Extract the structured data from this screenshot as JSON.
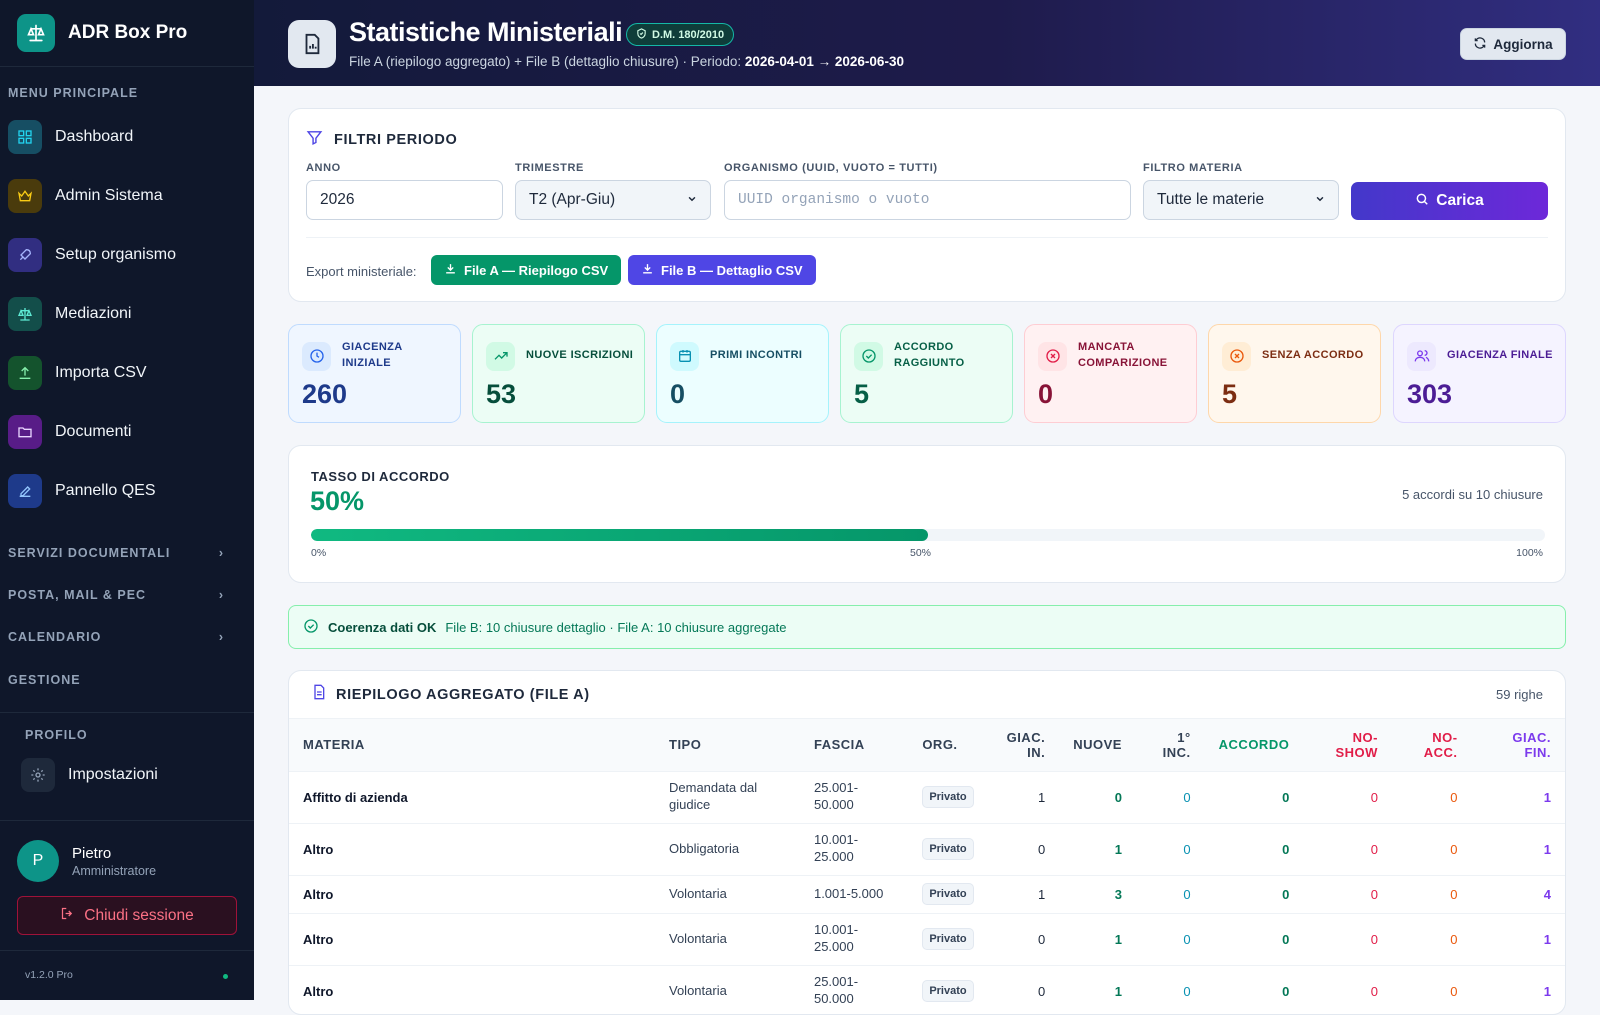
{
  "app": {
    "name": "ADR Box Pro",
    "version": "v1.2.0 Pro"
  },
  "sidebar": {
    "main_section": "MENU PRINCIPALE",
    "items": [
      {
        "label": "Dashboard",
        "icon": "grid-icon"
      },
      {
        "label": "Admin Sistema",
        "icon": "crown-icon"
      },
      {
        "label": "Setup organismo",
        "icon": "rocket-icon"
      },
      {
        "label": "Mediazioni",
        "icon": "scale-icon"
      },
      {
        "label": "Importa CSV",
        "icon": "upload-icon"
      },
      {
        "label": "Documenti",
        "icon": "folder-icon"
      },
      {
        "label": "Pannello QES",
        "icon": "edit-icon"
      }
    ],
    "groups": [
      "SERVIZI DOCUMENTALI",
      "POSTA, MAIL & PEC",
      "CALENDARIO"
    ],
    "gestione": "GESTIONE",
    "profile_section": "PROFILO",
    "settings_label": "Impostazioni",
    "user": {
      "initial": "P",
      "name": "Pietro",
      "role": "Amministratore"
    },
    "logout_label": "Chiudi sessione"
  },
  "header": {
    "title": "Statistiche Ministeriali",
    "badge": "D.M. 180/2010",
    "subtitle_prefix": "File A (riepilogo aggregato) + File B (dettaglio chiusure) · Periodo: ",
    "period": "2026-04-01 → 2026-06-30",
    "refresh_label": "Aggiorna"
  },
  "filters": {
    "title": "FILTRI PERIODO",
    "anno_label": "ANNO",
    "anno_value": "2026",
    "trimestre_label": "TRIMESTRE",
    "trimestre_value": "T2 (Apr-Giu)",
    "organismo_label": "ORGANISMO (UUID, VUOTO = TUTTI)",
    "organismo_placeholder": "UUID organismo o vuoto",
    "materia_label": "FILTRO MATERIA",
    "materia_value": "Tutte le materie",
    "load_label": "Carica",
    "export_label": "Export ministeriale:",
    "file_a_label": "File A — Riepilogo CSV",
    "file_b_label": "File B — Dettaglio CSV"
  },
  "stats": [
    {
      "label": "GIACENZA INIZIALE",
      "value": "260",
      "color": "#1e3a8a"
    },
    {
      "label": "NUOVE ISCRIZIONI",
      "value": "53",
      "color": "#064e3b"
    },
    {
      "label": "PRIMI INCONTRI",
      "value": "0",
      "color": "#164e63"
    },
    {
      "label": "ACCORDO RAGGIUNTO",
      "value": "5",
      "color": "#065f46"
    },
    {
      "label": "MANCATA COMPARIZIONE",
      "value": "0",
      "color": "#881337"
    },
    {
      "label": "SENZA ACCORDO",
      "value": "5",
      "color": "#7c2d12"
    },
    {
      "label": "GIACENZA FINALE",
      "value": "303",
      "color": "#4c1d95"
    }
  ],
  "rate": {
    "title": "TASSO DI ACCORDO",
    "value": "50%",
    "fraction": 0.5,
    "note": "5 accordi su 10 chiusure",
    "ticks": [
      "0%",
      "50%",
      "100%"
    ]
  },
  "coherence": {
    "title": "Coerenza dati OK",
    "text": "File B: 10 chiusure dettaglio · File A: 10 chiusure aggregate"
  },
  "table": {
    "title": "RIEPILOGO AGGREGATO (FILE A)",
    "count": "59 righe",
    "columns": [
      {
        "label": "MATERIA"
      },
      {
        "label": "TIPO"
      },
      {
        "label": "FASCIA"
      },
      {
        "label": "ORG."
      },
      {
        "label": "GIAC. IN."
      },
      {
        "label": "NUOVE"
      },
      {
        "label": "1° INC."
      },
      {
        "label": "ACCORDO"
      },
      {
        "label": "NO-SHOW"
      },
      {
        "label": "NO-ACC."
      },
      {
        "label": "GIAC. FIN."
      }
    ],
    "rows": [
      [
        "Affitto di azienda",
        "Demandata dal giudice",
        "25.001-50.000",
        "Privato",
        "1",
        "0",
        "0",
        "0",
        "0",
        "0",
        "1"
      ],
      [
        "Altro",
        "Obbligatoria",
        "10.001-25.000",
        "Privato",
        "0",
        "1",
        "0",
        "0",
        "0",
        "0",
        "1"
      ],
      [
        "Altro",
        "Volontaria",
        "1.001-5.000",
        "Privato",
        "1",
        "3",
        "0",
        "0",
        "0",
        "0",
        "4"
      ],
      [
        "Altro",
        "Volontaria",
        "10.001-25.000",
        "Privato",
        "0",
        "1",
        "0",
        "0",
        "0",
        "0",
        "1"
      ],
      [
        "Altro",
        "Volontaria",
        "25.001-50.000",
        "Privato",
        "0",
        "1",
        "0",
        "0",
        "0",
        "0",
        "1"
      ]
    ]
  }
}
